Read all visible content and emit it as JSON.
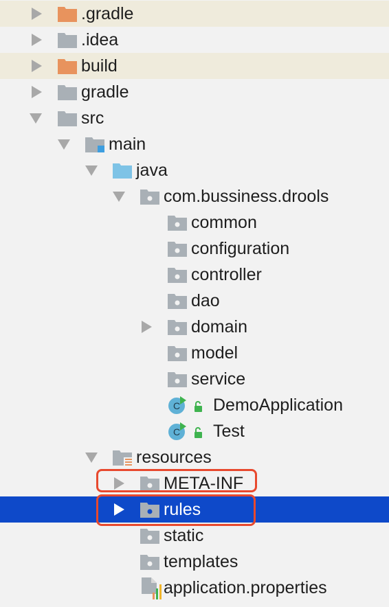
{
  "tree": {
    "items": [
      {
        "label": ".gradle",
        "icon": "folder-orange-icon",
        "arrow": "collapsed"
      },
      {
        "label": ".idea",
        "icon": "folder-gray-icon",
        "arrow": "collapsed"
      },
      {
        "label": "build",
        "icon": "folder-orange-icon",
        "arrow": "collapsed"
      },
      {
        "label": "gradle",
        "icon": "folder-gray-icon",
        "arrow": "collapsed"
      },
      {
        "label": "src",
        "icon": "folder-gray-icon",
        "arrow": "expanded"
      },
      {
        "label": "main",
        "icon": "source-root-folder-icon",
        "arrow": "expanded"
      },
      {
        "label": "java",
        "icon": "java-source-folder-icon",
        "arrow": "expanded"
      },
      {
        "label": "com.bussiness.drools",
        "icon": "package-icon",
        "arrow": "expanded"
      },
      {
        "label": "common",
        "icon": "package-icon",
        "arrow": "none"
      },
      {
        "label": "configuration",
        "icon": "package-icon",
        "arrow": "none"
      },
      {
        "label": "controller",
        "icon": "package-icon",
        "arrow": "none"
      },
      {
        "label": "dao",
        "icon": "package-icon",
        "arrow": "none"
      },
      {
        "label": "domain",
        "icon": "package-icon",
        "arrow": "collapsed"
      },
      {
        "label": "model",
        "icon": "package-icon",
        "arrow": "none"
      },
      {
        "label": "service",
        "icon": "package-icon",
        "arrow": "none"
      },
      {
        "label": "DemoApplication",
        "icon": "runnable-class-icon",
        "arrow": "none"
      },
      {
        "label": "Test",
        "icon": "runnable-class-icon",
        "arrow": "none"
      },
      {
        "label": "resources",
        "icon": "resources-folder-icon",
        "arrow": "expanded"
      },
      {
        "label": "META-INF",
        "icon": "package-icon",
        "arrow": "collapsed"
      },
      {
        "label": "rules",
        "icon": "package-icon",
        "arrow": "collapsed"
      },
      {
        "label": "static",
        "icon": "package-icon",
        "arrow": "none"
      },
      {
        "label": "templates",
        "icon": "package-icon",
        "arrow": "none"
      },
      {
        "label": "application.properties",
        "icon": "properties-file-icon",
        "arrow": "none"
      }
    ]
  },
  "colors": {
    "background": "#f2f2f2",
    "excluded_row": "#efebdc",
    "selection": "#0e49c9",
    "highlight_border": "#e8492e",
    "folder_orange": "#e8935d",
    "folder_gray": "#a9b0b6",
    "folder_blue": "#7ec3e6",
    "class_circle": "#5fb1d6",
    "run_green": "#3fb34f"
  }
}
